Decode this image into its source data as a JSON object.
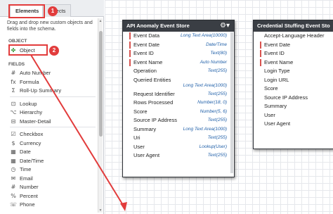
{
  "palette": {
    "tabs": [
      "Elements",
      "Objects"
    ],
    "hint": "Drag and drop new custom objects and fields into the schema.",
    "object_section": "OBJECT",
    "object_item": "Object",
    "fields_section": "FIELDS",
    "fields": [
      {
        "label": "Auto Number",
        "icon": "auto-number-icon",
        "glyph": "#"
      },
      {
        "label": "Formula",
        "icon": "formula-icon",
        "glyph": "fx"
      },
      {
        "label": "Roll-Up Summary",
        "icon": "rollup-icon",
        "glyph": "Σ"
      },
      {
        "label": "Lookup",
        "icon": "lookup-icon",
        "glyph": "⊡"
      },
      {
        "label": "Hierarchy",
        "icon": "hierarchy-icon",
        "glyph": "⌥"
      },
      {
        "label": "Master-Detail",
        "icon": "master-detail-icon",
        "glyph": "⊟"
      },
      {
        "label": "Checkbox",
        "icon": "checkbox-icon",
        "glyph": "☑"
      },
      {
        "label": "Currency",
        "icon": "currency-icon",
        "glyph": "$"
      },
      {
        "label": "Date",
        "icon": "date-icon",
        "glyph": "▦"
      },
      {
        "label": "Date/Time",
        "icon": "datetime-icon",
        "glyph": "▦"
      },
      {
        "label": "Time",
        "icon": "time-icon",
        "glyph": "◷"
      },
      {
        "label": "Email",
        "icon": "email-icon",
        "glyph": "✉"
      },
      {
        "label": "Number",
        "icon": "number-icon",
        "glyph": "#"
      },
      {
        "label": "Percent",
        "icon": "percent-icon",
        "glyph": "%"
      },
      {
        "label": "Phone",
        "icon": "phone-icon",
        "glyph": "☏"
      }
    ]
  },
  "badges": [
    "1",
    "2"
  ],
  "cards": [
    {
      "title": "API Anomaly Event Store",
      "rows": [
        {
          "label": "Event Data",
          "type": "Long Text Area(10000)",
          "req": true
        },
        {
          "label": "Event Date",
          "type": "Date/Time",
          "req": true
        },
        {
          "label": "Event ID",
          "type": "Text(80)",
          "req": true
        },
        {
          "label": "Event Name",
          "type": "Auto Number",
          "req": true
        },
        {
          "label": "Operation",
          "type": "Text(255)",
          "req": false
        },
        {
          "label": "Queried Entities",
          "type": "Long Text Area(1000)",
          "req": false,
          "two": true
        },
        {
          "label": "Request Identifier",
          "type": "Text(255)",
          "req": false
        },
        {
          "label": "Rows Processed",
          "type": "Number(18, 0)",
          "req": false
        },
        {
          "label": "Score",
          "type": "Number(5, 6)",
          "req": false
        },
        {
          "label": "Source IP Address",
          "type": "Text(255)",
          "req": false
        },
        {
          "label": "Summary",
          "type": "Long Text Area(1000)",
          "req": false
        },
        {
          "label": "Uri",
          "type": "Text(255)",
          "req": false
        },
        {
          "label": "User",
          "type": "Lookup(User)",
          "req": false
        },
        {
          "label": "User Agent",
          "type": "Text(255)",
          "req": false
        }
      ]
    },
    {
      "title": "Credential Stuffing Event Sto",
      "rows": [
        {
          "label": "Accept-Language Header",
          "type": "",
          "req": false
        },
        {
          "label": "Event Date",
          "type": "",
          "req": true
        },
        {
          "label": "Event ID",
          "type": "",
          "req": true
        },
        {
          "label": "Event Name",
          "type": "",
          "req": true
        },
        {
          "label": "Login Type",
          "type": "",
          "req": false
        },
        {
          "label": "Login URL",
          "type": "",
          "req": false
        },
        {
          "label": "Score",
          "type": "",
          "req": false
        },
        {
          "label": "Source IP Address",
          "type": "",
          "req": false
        },
        {
          "label": "Summary",
          "type": "",
          "req": false
        },
        {
          "label": "User",
          "type": "",
          "req": false
        },
        {
          "label": "User Agent",
          "type": "",
          "req": false
        }
      ]
    }
  ],
  "colors": {
    "highlight": "#e23c3c",
    "card_header": "#3a3e44",
    "field_type": "#1f5fa8"
  }
}
